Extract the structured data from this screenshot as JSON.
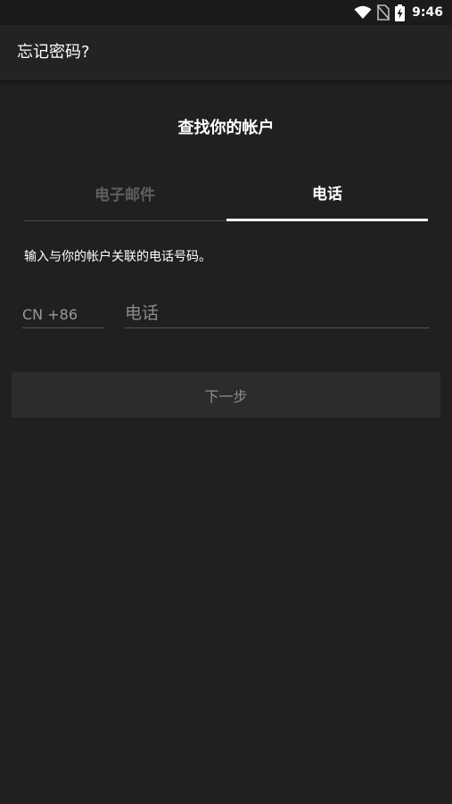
{
  "status_bar": {
    "time": "9:46",
    "icons": [
      "wifi-icon",
      "no-sim-icon",
      "battery-charging-icon"
    ]
  },
  "app_bar": {
    "title": "忘记密码?"
  },
  "page": {
    "heading": "查找你的帐户",
    "tabs": [
      {
        "label": "电子邮件",
        "selected": false
      },
      {
        "label": "电话",
        "selected": true
      }
    ],
    "instruction": "输入与你的帐户关联的电话号码。",
    "country_code": "CN +86",
    "phone_placeholder": "电话",
    "phone_value": "",
    "next_label": "下一步"
  },
  "colors": {
    "background": "#202020",
    "app_bar": "#232323",
    "selected_tab": "#ffffff",
    "unselected_tab": "#5f5f5f",
    "button": "#2c2c2f"
  }
}
